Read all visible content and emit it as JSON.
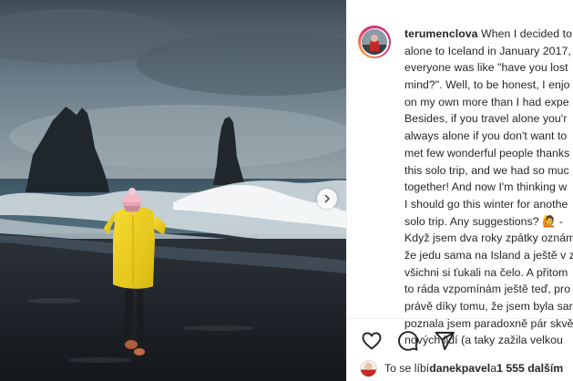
{
  "post": {
    "username": "terumenclova",
    "caption_lines": [
      {
        "text": "When I decided to"
      },
      {
        "text": "alone to Iceland in January 2017,"
      },
      {
        "text": "everyone was like \"have you lost"
      },
      {
        "text": "mind?\". Well, to be honest, I enjo"
      },
      {
        "text": "on my own more than I had expe"
      },
      {
        "text": "Besides, if you travel alone you'r"
      },
      {
        "text": "always alone if you don't want to"
      },
      {
        "text": "met few wonderful people thanks"
      },
      {
        "text": "this solo trip, and we had so muc"
      },
      {
        "text": "together! And now I'm thinking w"
      },
      {
        "text": "I should go this winter for anothe"
      },
      {
        "text": "solo trip. Any suggestions? 🙋 -"
      },
      {
        "text": "Když jsem dva roky zpátky oznám"
      },
      {
        "text": "že jedu sama na Island a ještě v z"
      },
      {
        "text": "všichni si ťukali na čelo. A přitom"
      },
      {
        "text": "to ráda vzpomínám ještě teď, pro"
      },
      {
        "text": "právě díky tomu, že jsem byla sar"
      },
      {
        "text": "poznala jsem paradoxně pár skvě"
      },
      {
        "text": "nových lidí (a taky zažila velkou"
      }
    ]
  },
  "actions": {
    "like_icon": "heart-icon",
    "comment_icon": "comment-icon",
    "share_icon": "paper-plane-icon"
  },
  "likes": {
    "prefix": "To se líbí ",
    "user": "danekpavel",
    "middle": " a ",
    "count": "1 555 dalším"
  },
  "colors": {
    "text": "#262626",
    "raincoat": "#f2d21e",
    "story_ring_start": "#f9c53a",
    "story_ring_end": "#c13584"
  }
}
